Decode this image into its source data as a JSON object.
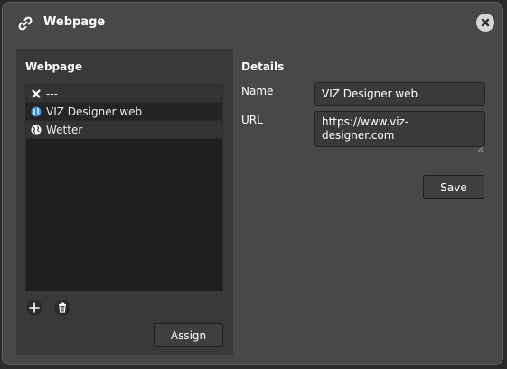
{
  "dialog": {
    "title": "Webpage",
    "title_icon": "link-icon",
    "close_icon": "close-icon"
  },
  "left_panel": {
    "title": "Webpage",
    "items": [
      {
        "label": "---",
        "icon": "x-icon"
      },
      {
        "label": "VIZ Designer web",
        "icon": "globe-icon"
      },
      {
        "label": "Wetter",
        "icon": "globe-icon"
      }
    ],
    "add_icon": "plus-icon",
    "delete_icon": "trash-icon",
    "assign_label": "Assign"
  },
  "details": {
    "title": "Details",
    "name_label": "Name",
    "name_value": "VIZ Designer web",
    "url_label": "URL",
    "url_value": "https://www.viz-designer.com",
    "save_label": "Save"
  },
  "colors": {
    "dialog_bg": "#484848",
    "panel_bg": "#393939",
    "list_bg": "#1e1e1e",
    "globe_blue": "#3a8fd6"
  }
}
